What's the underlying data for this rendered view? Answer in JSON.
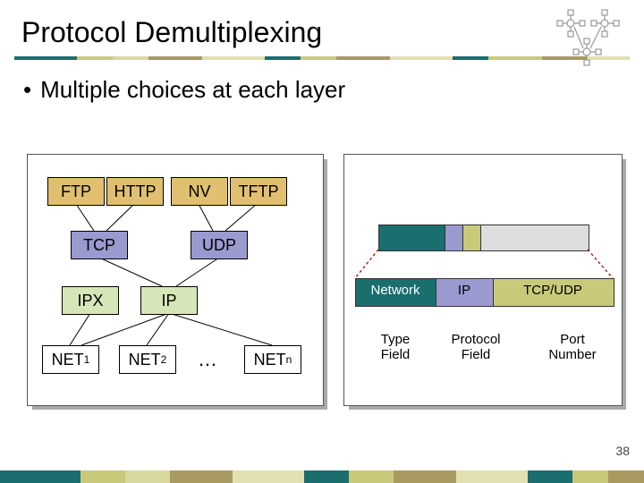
{
  "title": "Protocol Demultiplexing",
  "bullet": "Multiple choices at each layer",
  "left": {
    "apps": [
      "FTP",
      "HTTP",
      "NV",
      "TFTP"
    ],
    "trans": [
      "TCP",
      "UDP"
    ],
    "nets_label": [
      "IPX",
      "IP"
    ],
    "links": [
      "NET",
      "NET",
      "NET"
    ],
    "link_subs": [
      "1",
      "2",
      "n"
    ],
    "ellipsis": "…"
  },
  "right": {
    "segments": [
      "Network",
      "IP",
      "TCP/UDP"
    ],
    "sublabels": [
      "Type\nField",
      "Protocol\nField",
      "Port\nNumber"
    ]
  },
  "page": "38"
}
